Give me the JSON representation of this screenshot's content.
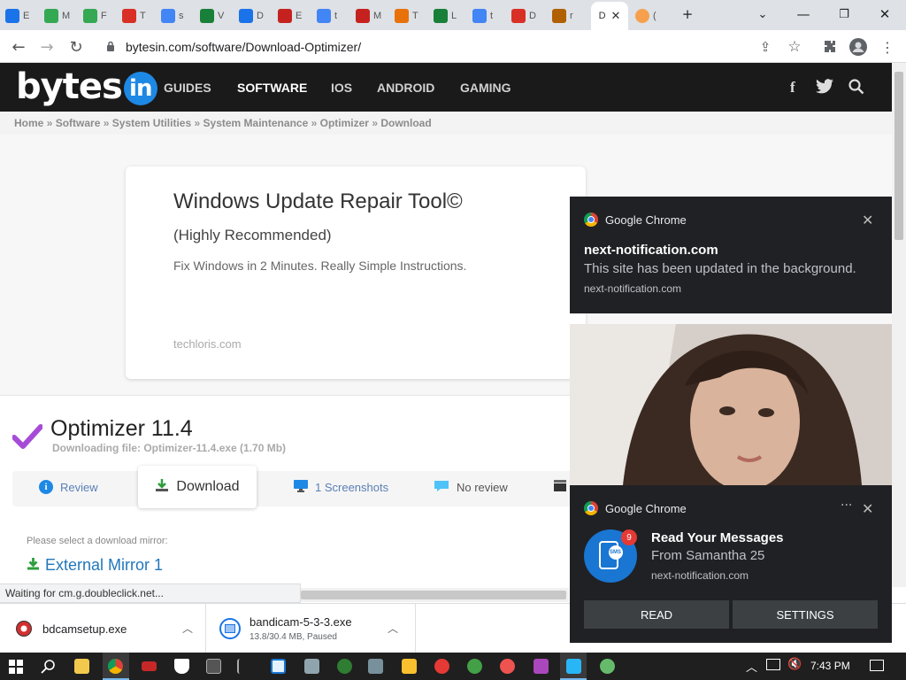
{
  "browser": {
    "tabs": [
      {
        "letter": "E",
        "color": "#1a73e8"
      },
      {
        "letter": "M",
        "color": "#34a853"
      },
      {
        "letter": "F",
        "color": "#34a853"
      },
      {
        "letter": "T",
        "color": "#d93025"
      },
      {
        "letter": "s",
        "color": "#4285f4"
      },
      {
        "letter": "V",
        "color": "#188038"
      },
      {
        "letter": "D",
        "color": "#1a73e8"
      },
      {
        "letter": "E",
        "color": "#c5221f"
      },
      {
        "letter": "t",
        "color": "#4285f4"
      },
      {
        "letter": "M",
        "color": "#c5221f"
      },
      {
        "letter": "T",
        "color": "#e8710a"
      },
      {
        "letter": "L",
        "color": "#188038"
      },
      {
        "letter": "t",
        "color": "#4285f4"
      },
      {
        "letter": "D",
        "color": "#d93025"
      },
      {
        "letter": "r",
        "color": "#b06000"
      }
    ],
    "active_tab_label": "D",
    "last_tab_label": "(",
    "url": "bytesin.com/software/Download-Optimizer/"
  },
  "site": {
    "logo_text": "bytes",
    "logo_badge": "in",
    "nav": [
      "GUIDES",
      "SOFTWARE",
      "IOS",
      "ANDROID",
      "GAMING"
    ],
    "breadcrumb": [
      "Home",
      "Software",
      "System Utilities",
      "System Maintenance",
      "Optimizer",
      "Download"
    ],
    "breadcrumb_sep": "»"
  },
  "ad": {
    "title": "Windows Update Repair Tool©",
    "subtitle": "(Highly Recommended)",
    "description": "Fix Windows in 2 Minutes. Really Simple Instructions.",
    "domain": "techloris.com"
  },
  "product": {
    "title": "Optimizer 11.4",
    "file_line": "Downloading file: Optimizer-11.4.exe (1.70 Mb)",
    "tabs": {
      "review": "Review",
      "download": "Download",
      "screenshots": "1 Screenshots",
      "no_review": "No review"
    },
    "mirror_hint": "Please select a download mirror:",
    "mirror_link": "External Mirror 1"
  },
  "status_bar": "Waiting for cm.g.doubleclick.net...",
  "downloads": [
    {
      "name": "bdcamsetup.exe",
      "detail": ""
    },
    {
      "name": "bandicam-5-3-3.exe",
      "detail": "13.8/30.4 MB, Paused"
    }
  ],
  "notifications": [
    {
      "app": "Google Chrome",
      "title": "next-notification.com",
      "body": "This site has been updated in the background.",
      "origin": "next-notification.com"
    },
    {
      "app": "Google Chrome",
      "title": "Read Your Messages",
      "body": "From Samantha 25",
      "origin": "next-notification.com",
      "badge_count": "9",
      "icon_label": "SMS",
      "more": "···",
      "buttons": [
        "READ",
        "SETTINGS"
      ]
    }
  ],
  "taskbar": {
    "time": "7:43 PM"
  },
  "colors": {
    "site_header": "#1a1a1a",
    "notification_bg": "#202124",
    "link_blue": "#2277bb",
    "check_purple": "#a64bd8",
    "sms_blue": "#1976d2",
    "badge_red": "#e53935"
  }
}
